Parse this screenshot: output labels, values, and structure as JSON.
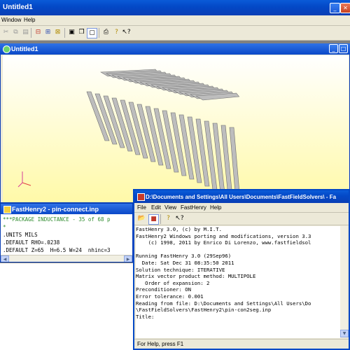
{
  "main_window": {
    "title": "Untitled1",
    "menu": [
      "Window",
      "Help"
    ]
  },
  "child_window": {
    "title": "Untitled1"
  },
  "fh2_console": {
    "title": "FastHenry2 - pin-connect.inp",
    "lines": [
      {
        "text": "***PACKAGE INDUCTANCE - 35 of 68 p",
        "color": "#2E8B2E"
      },
      {
        "text": "*",
        "color": "#2E8B2E"
      },
      {
        "text": ".UNITS MILS",
        "color": "#000000"
      },
      {
        "text": ".DEFAULT RHO=.0238",
        "color": "#000000"
      },
      {
        "text": ".DEFAULT Z=65  H=6.5 W=24  nhinc=3",
        "color": "#000000"
      }
    ]
  },
  "fh_output": {
    "title": "D:\\Documents and Settings\\All Users\\Documents\\FastFieldSolvers\\ - Fa",
    "menu": [
      "File",
      "Edit",
      "View",
      "FastHenry",
      "Help"
    ],
    "lines": [
      "FastHenry 3.0, (c) by M.I.T.",
      "FastHenry2 Windows porting and modifications, version 3.3",
      "    (c) 1998, 2011 by Enrico Di Lorenzo, www.fastfieldsol",
      "",
      "Running FastHenry 3.0 (29Sep96)",
      "  Date: Sat Dec 31 08:35:50 2011",
      "Solution technique: ITERATIVE",
      "Matrix vector product method: MULTIPOLE",
      "   Order of expansion: 2",
      "Preconditioner: ON",
      "Error tolerance: 0.001",
      "Reading from file: D:\\Documents and Settings\\All Users\\Do",
      "\\FastFieldSolvers\\FastHenry2\\pin-con2seg.inp",
      "Title:"
    ],
    "status": "For Help, press F1"
  }
}
